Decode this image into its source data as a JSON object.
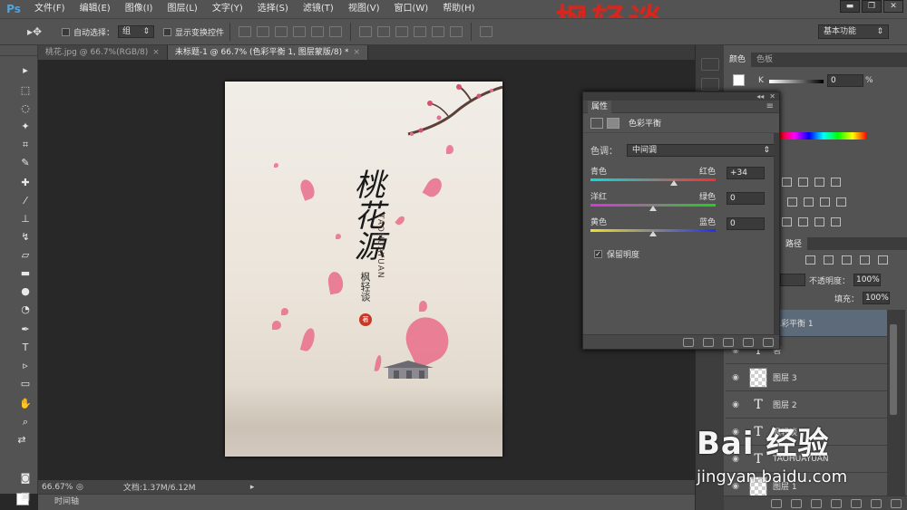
{
  "app": {
    "logo": "Ps",
    "watermark_title": "枫轻谈",
    "menu": [
      "文件(F)",
      "编辑(E)",
      "图像(I)",
      "图层(L)",
      "文字(Y)",
      "选择(S)",
      "滤镜(T)",
      "视图(V)",
      "窗口(W)",
      "帮助(H)"
    ],
    "window_controls": [
      "▬",
      "❐",
      "✕"
    ]
  },
  "options_bar": {
    "tool_icon": "move-tool-icon",
    "auto_select_label": "自动选择：",
    "auto_select_value": "组",
    "show_transform_label": "显示变换控件",
    "workspace": "基本功能"
  },
  "tabs": [
    {
      "label": "桃花.jpg @ 66.7%(RGB/8)",
      "close": "×",
      "active": false
    },
    {
      "label": "未标题-1 @ 66.7% (色彩平衡 1, 图层蒙版/8) *",
      "close": "×",
      "active": true
    }
  ],
  "status": {
    "zoom": "66.67%",
    "doc_size": "文档:1.37M/6.12M",
    "timeline": "时间轴"
  },
  "poster": {
    "title": "桃花源",
    "pinyin": "TAOHUAYUAN",
    "author": "枫轻谈",
    "seal": "著"
  },
  "properties": {
    "panel_title": "属性",
    "collapse": "◂◂",
    "close": "✕",
    "header_label": "色彩平衡",
    "tone_label": "色调：",
    "tone_value": "中间调",
    "sliders": [
      {
        "left": "青色",
        "right": "红色",
        "value": "+34",
        "position": 0.67
      },
      {
        "left": "洋红",
        "right": "绿色",
        "value": "0",
        "position": 0.5
      },
      {
        "left": "黄色",
        "right": "蓝色",
        "value": "0",
        "position": 0.5
      }
    ],
    "preserve_label": "保留明度",
    "preserve_checked": true
  },
  "color_panel": {
    "tabs": [
      "颜色",
      "色板"
    ],
    "channel": "K",
    "value": "0",
    "unit": "%"
  },
  "layers_panel": {
    "tab": "路径",
    "opacity_label": "不透明度：",
    "opacity_value": "100%",
    "fill_label": "填充：",
    "fill_value": "100%",
    "layers": [
      {
        "name": "色彩平衡 1",
        "type": "adjustment",
        "selected": true
      },
      {
        "name": "著",
        "type": "text",
        "selected": false
      },
      {
        "name": "图层 3",
        "type": "pixel",
        "selected": false
      },
      {
        "name": "图层 2",
        "type": "text",
        "selected": false
      },
      {
        "name": "枫轻谈",
        "type": "text",
        "selected": false
      },
      {
        "name": "TAOHUAYUAN",
        "type": "text",
        "selected": false
      },
      {
        "name": "图层 1",
        "type": "pixel",
        "selected": false
      }
    ]
  },
  "watermark": {
    "baidu": "Bai 经验",
    "url": "jingyan.baidu.com"
  },
  "colors": {
    "accent_red": "#d8261c",
    "petal_pink": "#e96d8a",
    "selected_layer": "#5d6a7a"
  }
}
